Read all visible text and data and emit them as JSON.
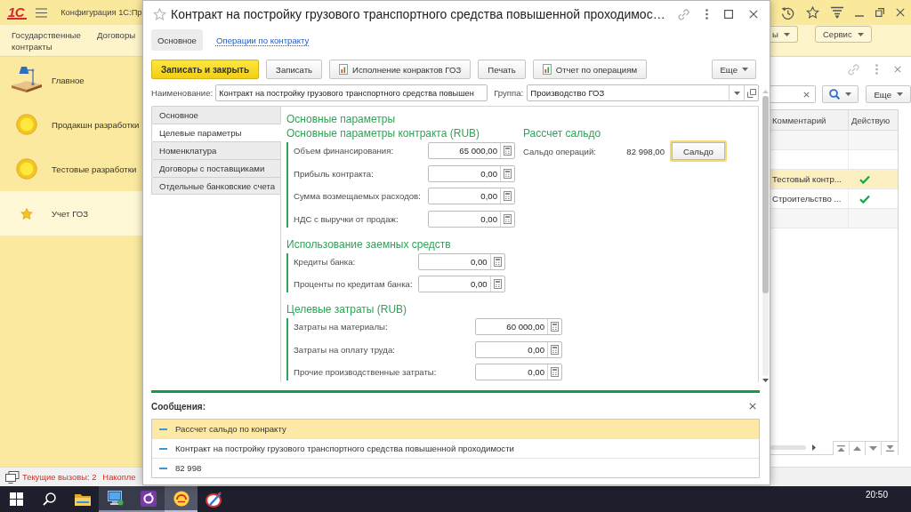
{
  "app": {
    "logo": "1С",
    "title": "Конфигурация 1С:Пр"
  },
  "sections": {
    "items": [
      "Государственные контракты",
      "Договоры"
    ],
    "buttons": [
      "ы",
      "Сервис"
    ]
  },
  "sidebar": {
    "items": [
      {
        "label": "Главное",
        "kind": "desk",
        "selected": false
      },
      {
        "label": "Продакшн разработки",
        "kind": "circle",
        "selected": false
      },
      {
        "label": "Тестовые разработки",
        "kind": "circle",
        "selected": false
      },
      {
        "label": "Учет ГОЗ",
        "kind": "star",
        "selected": true
      }
    ]
  },
  "list_panel": {
    "more_button": "Еще",
    "columns": [
      "Комментарий",
      "Действую"
    ],
    "rows": [
      {
        "selected": false,
        "active": false
      },
      {
        "selected": false,
        "active": false
      },
      {
        "comment": "Тестовый контр...",
        "selected": true,
        "active": true
      },
      {
        "comment": "Строительство ...",
        "selected": false,
        "active": true
      },
      {
        "selected": false,
        "active": false
      }
    ]
  },
  "form": {
    "title": "Контракт на постройку грузового транспортного средства повышенной проходимос…",
    "tabs": [
      {
        "label": "Основное",
        "selected": true
      },
      {
        "label": "Операции по контракту",
        "selected": false
      }
    ],
    "commands": [
      {
        "label": "Записать и закрыть",
        "kind": "primary"
      },
      {
        "label": "Записать",
        "kind": "plain"
      },
      {
        "label": "Исполнение конрактов ГОЗ",
        "kind": "report"
      },
      {
        "label": "Печать",
        "kind": "plain"
      },
      {
        "label": "Отчет по операциям",
        "kind": "report"
      },
      {
        "label": "Еще",
        "kind": "menu"
      }
    ],
    "name_field": {
      "label": "Наименование:",
      "value": "Контракт на постройку грузового транспортного средства повышен"
    },
    "group_field": {
      "label": "Группа:",
      "value": "Производство ГОЗ"
    },
    "pages": [
      {
        "label": "Основное",
        "selected": false
      },
      {
        "label": "Целевые параметры",
        "selected": true
      },
      {
        "label": "Номенклатура",
        "selected": false
      },
      {
        "label": "Договоры с поставщиками",
        "selected": false
      },
      {
        "label": "Отдельные банковские счета",
        "selected": false
      }
    ],
    "heading": "Основные параметры",
    "groups": [
      {
        "title": "Основные параметры контракта (RUB)",
        "fields": [
          {
            "label": "Объем финансирования:",
            "value": "65 000,00"
          },
          {
            "label": "Прибыль контракта:",
            "value": "0,00"
          },
          {
            "label": "Сумма возмещаемых расходов:",
            "value": "0,00"
          },
          {
            "label": "НДС с выручки от продаж:",
            "value": "0,00"
          }
        ]
      },
      {
        "title": "Использование заемных средств",
        "fields": [
          {
            "label": "Кредиты банка:",
            "value": "0,00"
          },
          {
            "label": "Проценты по кредитам банка:",
            "value": "0,00"
          }
        ]
      },
      {
        "title": "Целевые затраты (RUB)",
        "fields": [
          {
            "label": "Затраты на материалы:",
            "value": "60 000,00"
          },
          {
            "label": "Затраты на оплату труда:",
            "value": "0,00"
          },
          {
            "label": "Прочие производственные затраты:",
            "value": "0,00"
          }
        ]
      }
    ],
    "balance": {
      "title": "Рассчет сальдо",
      "label": "Сальдо операций:",
      "value": "82 998,00",
      "button": "Сальдо",
      "focused": true
    }
  },
  "messages": {
    "title": "Сообщения:",
    "items": [
      {
        "text": "Рассчет сальдо по конракту",
        "selected": true
      },
      {
        "text": "Контракт на постройку грузового транспортного средства повышенной проходимости",
        "selected": false
      },
      {
        "text": "82 998",
        "selected": false
      }
    ]
  },
  "status_bar": {
    "items": [
      "Текущие вызовы: 2",
      "Накопле"
    ]
  },
  "taskbar": {
    "apps": [
      {
        "kind": "folder",
        "running": false,
        "selected": false
      },
      {
        "kind": "computer",
        "running": true,
        "selected": false
      },
      {
        "kind": "ring",
        "running": true,
        "selected": false
      },
      {
        "kind": "disc",
        "running": true,
        "selected": true
      },
      {
        "kind": "pen",
        "running": false,
        "selected": false
      }
    ],
    "clock": "20:50"
  }
}
